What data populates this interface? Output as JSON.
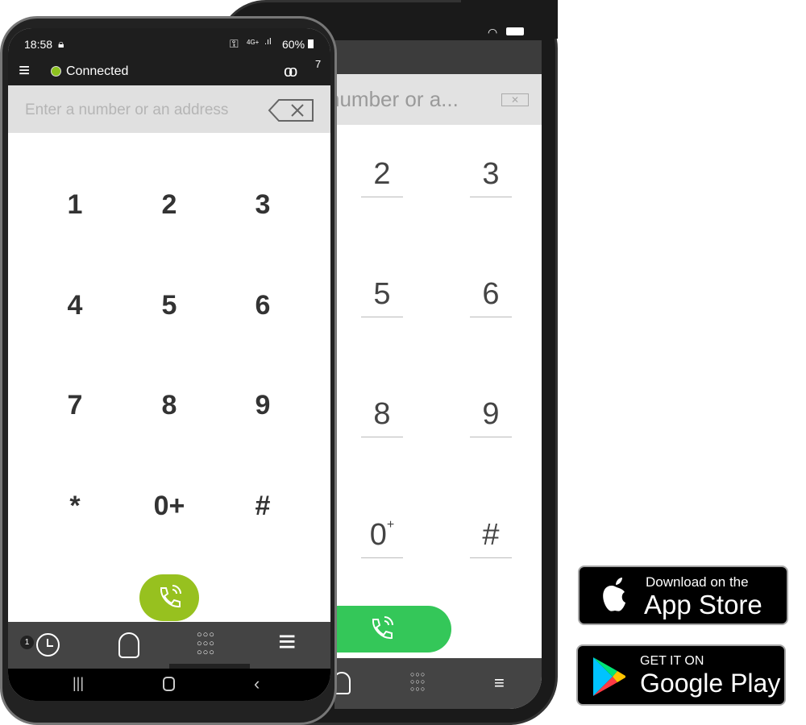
{
  "front_phone": {
    "status_bar": {
      "time": "18:58",
      "battery": "60%",
      "network": "4G+"
    },
    "header": {
      "status": "Connected",
      "status_color": "#8dc21f",
      "voicemail_count": "7"
    },
    "input": {
      "placeholder": "Enter a number or an address"
    },
    "keys": [
      "1",
      "2",
      "3",
      "4",
      "5",
      "6",
      "7",
      "8",
      "9",
      "*",
      "0+",
      "#"
    ],
    "call_color": "#97c11f",
    "nav": {
      "history_badge": "1"
    }
  },
  "back_phone": {
    "input": {
      "placeholder": "number or a..."
    },
    "keys": [
      "2",
      "3",
      "5",
      "6",
      "8",
      "9",
      "0",
      "#"
    ],
    "zero_sup": "+",
    "call_color": "#34c759"
  },
  "badges": {
    "app_store": {
      "small": "Download on the",
      "large": "App Store"
    },
    "google_play": {
      "small": "GET IT ON",
      "large": "Google Play"
    }
  }
}
